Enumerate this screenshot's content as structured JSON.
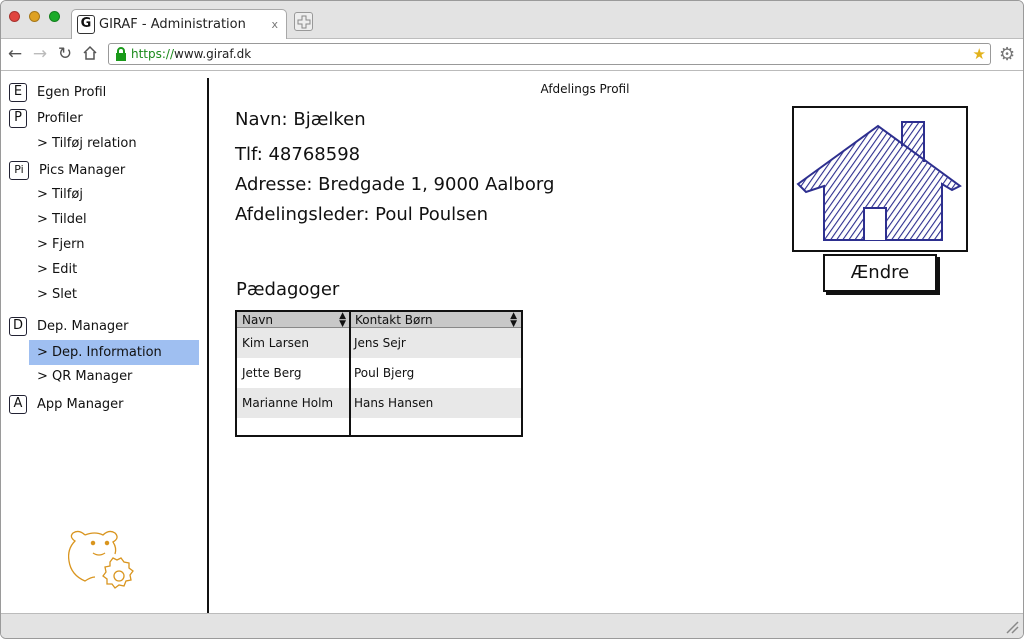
{
  "browser": {
    "tab_title": "GIRAF - Administration",
    "tab_favicon": "G",
    "tab_close": "x",
    "url_scheme": "https://",
    "url_host": "www.giraf.dk"
  },
  "sidebar": {
    "sections": [
      {
        "badge": "E",
        "label": "Egen Profil"
      },
      {
        "badge": "P",
        "label": "Profiler"
      },
      {
        "badge": "Pi",
        "label": "Pics Manager"
      },
      {
        "badge": "D",
        "label": "Dep. Manager"
      },
      {
        "badge": "A",
        "label": "App Manager"
      }
    ],
    "subitems": {
      "tilfoj_relation": "> Tilføj relation",
      "tilfoj": "> Tilføj",
      "tildel": "> Tildel",
      "fjern": "> Fjern",
      "edit": "> Edit",
      "slet": "> Slet",
      "dep_information": "> Dep. Information",
      "qr_manager": "> QR Manager"
    }
  },
  "main": {
    "page_title": "Afdelings Profil",
    "info": {
      "navn": "Navn: Bjælken",
      "tlf": "Tlf: 48768598",
      "adresse": "Adresse: Bredgade 1, 9000 Aalborg",
      "leder": "Afdelingsleder: Poul Poulsen"
    },
    "change_button": "Ændre",
    "pedagogues_title": "Pædagoger",
    "table": {
      "headers": [
        "Navn",
        "Kontakt Børn"
      ],
      "rows": [
        [
          "Kim Larsen",
          "Jens Sejr"
        ],
        [
          "Jette Berg",
          "Poul Bjerg"
        ],
        [
          "Marianne Holm",
          "Hans Hansen"
        ]
      ]
    }
  },
  "colors": {
    "active_nav": "#9fbff1",
    "house_sketch": "#2d2f8f",
    "logo": "#d9951f"
  }
}
